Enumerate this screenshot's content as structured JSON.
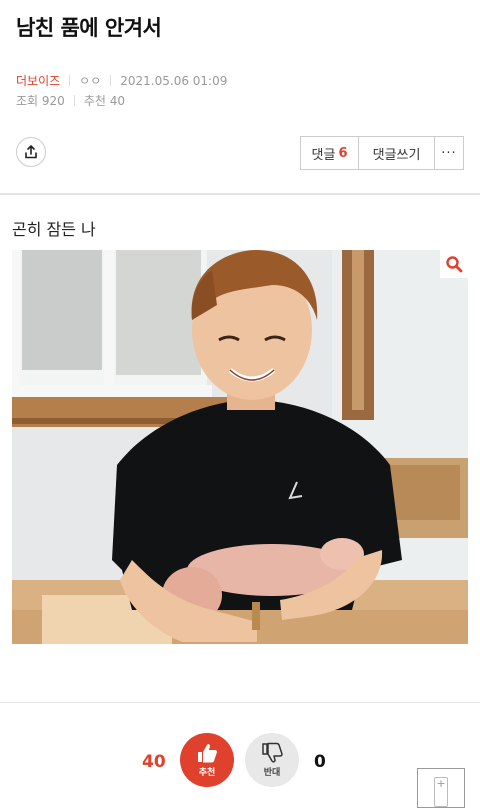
{
  "post": {
    "title": "남친 품에 안겨서",
    "category": "더보이즈",
    "author": "ㅇㅇ",
    "datetime": "2021.05.06 01:09",
    "views_label": "조회 920",
    "recommend_label": "추천 40",
    "body_text": "곤히 잠든 나"
  },
  "toolbar": {
    "comments_label": "댓글",
    "comments_count": "6",
    "write_comment_label": "댓글쓰기",
    "more_label": "···"
  },
  "votes": {
    "up_count": "40",
    "up_label": "추천",
    "down_count": "0",
    "down_label": "반대"
  },
  "colors": {
    "accent": "#e0412c"
  },
  "icons": {
    "share": "share-icon",
    "zoom": "magnifier-icon",
    "thumbs_up": "thumbs-up-icon",
    "thumbs_down": "thumbs-down-icon"
  }
}
